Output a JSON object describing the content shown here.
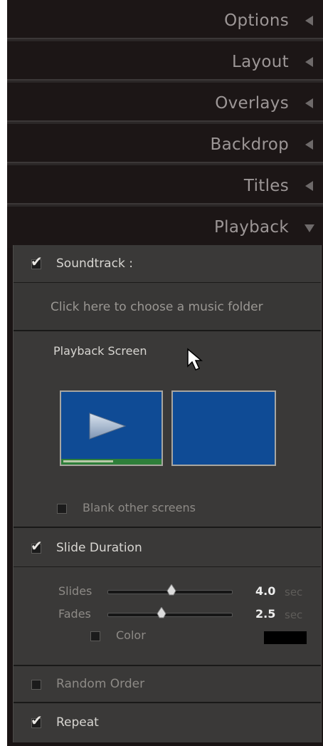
{
  "panels": [
    {
      "label": "Options",
      "state": "collapsed"
    },
    {
      "label": "Layout",
      "state": "collapsed"
    },
    {
      "label": "Overlays",
      "state": "collapsed"
    },
    {
      "label": "Backdrop",
      "state": "collapsed"
    },
    {
      "label": "Titles",
      "state": "collapsed"
    },
    {
      "label": "Playback",
      "state": "expanded"
    }
  ],
  "playback": {
    "soundtrack": {
      "label": "Soundtrack :",
      "checked": true
    },
    "music_folder_prompt": "Click here to choose a music folder",
    "screen": {
      "label": "Playback Screen"
    },
    "blank_other": {
      "label": "Blank other screens",
      "checked": false
    },
    "slide_duration": {
      "label": "Slide Duration",
      "checked": true
    },
    "slides": {
      "label": "Slides",
      "value": "4.0",
      "unit": "sec",
      "level": 0.52
    },
    "fades": {
      "label": "Fades",
      "value": "2.5",
      "unit": "sec",
      "level": 0.42
    },
    "color": {
      "label": "Color",
      "checked": false,
      "swatch": "#000000"
    },
    "random_order": {
      "label": "Random Order",
      "checked": false
    },
    "repeat": {
      "label": "Repeat",
      "checked": true
    }
  },
  "colors": {
    "screen_blue": "#0f4b95",
    "panel_bg": "#3a3938",
    "header_bg": "#1c1616"
  }
}
